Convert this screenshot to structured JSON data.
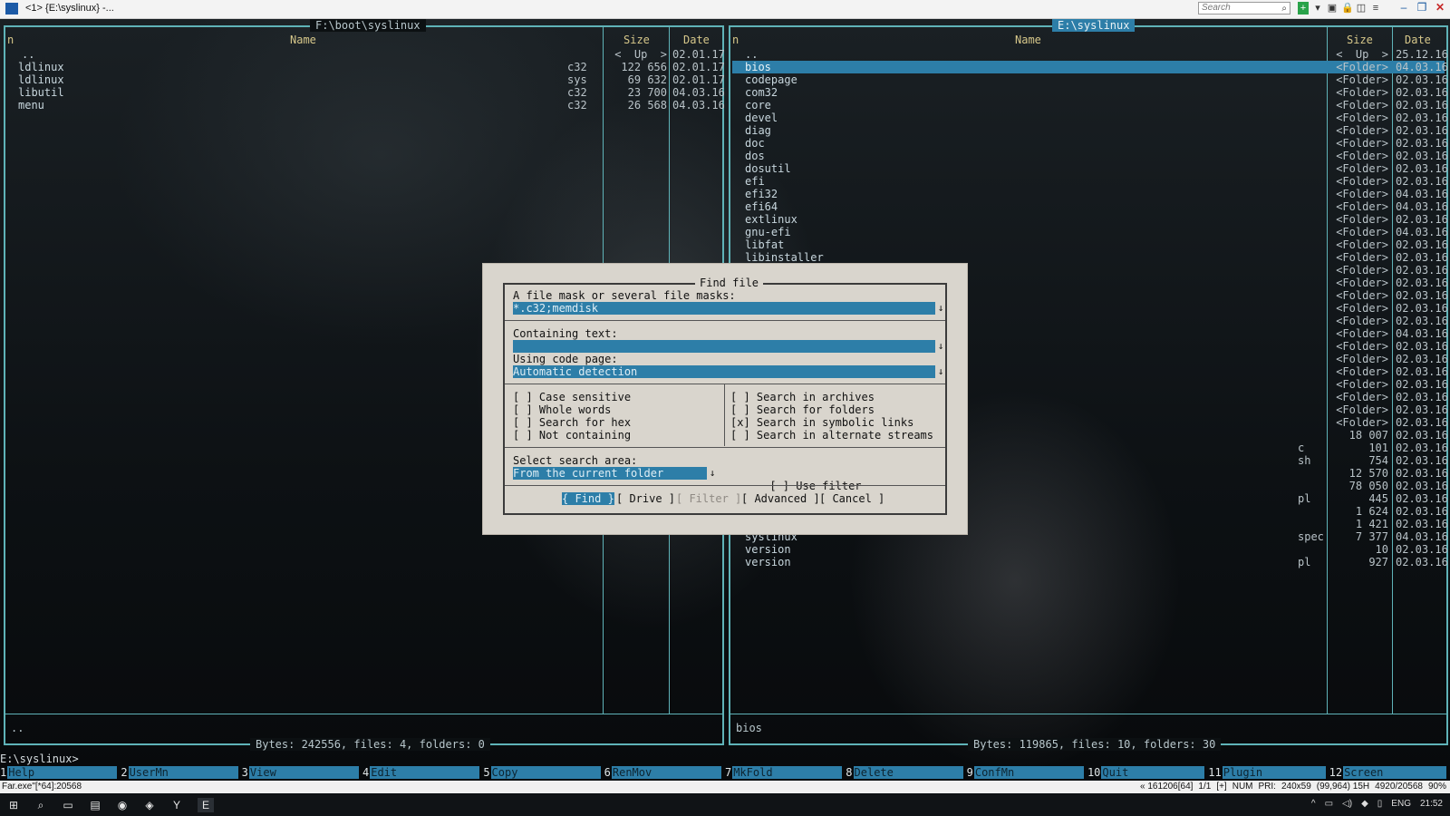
{
  "window": {
    "title": "<1> {E:\\syslinux} -...",
    "search_placeholder": "Search"
  },
  "left_panel": {
    "path": "F:\\boot\\syslinux",
    "col_name": "Name",
    "col_size": "Size",
    "col_date": "Date",
    "updir": "..",
    "up_size": "<  Up  >",
    "up_date": "02.01.17",
    "files": [
      {
        "name": "ldlinux",
        "ext": "c32",
        "size": "122 656",
        "date": "02.01.17"
      },
      {
        "name": "ldlinux",
        "ext": "sys",
        "size": "69 632",
        "date": "02.01.17"
      },
      {
        "name": "libutil",
        "ext": "c32",
        "size": "23 700",
        "date": "04.03.16"
      },
      {
        "name": "menu",
        "ext": "c32",
        "size": "26 568",
        "date": "04.03.16"
      }
    ],
    "status": "..",
    "bytes": "Bytes: 242556, files: 4, folders: 0"
  },
  "right_panel": {
    "path": "E:\\syslinux",
    "col_n": "n",
    "col_name": "Name",
    "col_size": "Size",
    "col_date": "Date",
    "updir": "..",
    "up_size": "<  Up  >",
    "up_date": "25.12.16",
    "folders": [
      {
        "name": "bios",
        "size": "<Folder>",
        "date": "04.03.16"
      },
      {
        "name": "codepage",
        "size": "<Folder>",
        "date": "02.03.16"
      },
      {
        "name": "com32",
        "size": "<Folder>",
        "date": "02.03.16"
      },
      {
        "name": "core",
        "size": "<Folder>",
        "date": "02.03.16"
      },
      {
        "name": "devel",
        "size": "<Folder>",
        "date": "02.03.16"
      },
      {
        "name": "diag",
        "size": "<Folder>",
        "date": "02.03.16"
      },
      {
        "name": "doc",
        "size": "<Folder>",
        "date": "02.03.16"
      },
      {
        "name": "dos",
        "size": "<Folder>",
        "date": "02.03.16"
      },
      {
        "name": "dosutil",
        "size": "<Folder>",
        "date": "02.03.16"
      },
      {
        "name": "efi",
        "size": "<Folder>",
        "date": "02.03.16"
      },
      {
        "name": "efi32",
        "size": "<Folder>",
        "date": "04.03.16"
      },
      {
        "name": "efi64",
        "size": "<Folder>",
        "date": "04.03.16"
      },
      {
        "name": "extlinux",
        "size": "<Folder>",
        "date": "02.03.16"
      },
      {
        "name": "gnu-efi",
        "size": "<Folder>",
        "date": "04.03.16"
      },
      {
        "name": "libfat",
        "size": "<Folder>",
        "date": "02.03.16"
      },
      {
        "name": "libinstaller",
        "size": "<Folder>",
        "date": "02.03.16"
      }
    ],
    "hidden_rows": [
      {
        "size": "<Folder>",
        "date": "02.03.16"
      },
      {
        "size": "<Folder>",
        "date": "02.03.16"
      },
      {
        "size": "<Folder>",
        "date": "02.03.16"
      },
      {
        "size": "<Folder>",
        "date": "02.03.16"
      },
      {
        "size": "<Folder>",
        "date": "02.03.16"
      },
      {
        "size": "<Folder>",
        "date": "04.03.16"
      },
      {
        "size": "<Folder>",
        "date": "02.03.16"
      },
      {
        "size": "<Folder>",
        "date": "02.03.16"
      },
      {
        "size": "<Folder>",
        "date": "02.03.16"
      },
      {
        "size": "<Folder>",
        "date": "02.03.16"
      },
      {
        "size": "<Folder>",
        "date": "02.03.16"
      },
      {
        "size": "<Folder>",
        "date": "02.03.16"
      },
      {
        "size": "<Folder>",
        "date": "02.03.16"
      },
      {
        "ext": "",
        "size": "18 007",
        "date": "02.03.16"
      },
      {
        "ext": "c",
        "size": "101",
        "date": "02.03.16"
      },
      {
        "ext": "sh",
        "size": "754",
        "date": "02.03.16"
      },
      {
        "ext": "",
        "size": "12 570",
        "date": "02.03.16"
      },
      {
        "ext": "",
        "size": "78 050",
        "date": "02.03.16"
      },
      {
        "ext": "pl",
        "size": "445",
        "date": "02.03.16"
      },
      {
        "ext": "",
        "size": "1 624",
        "date": "02.03.16"
      },
      {
        "ext": "",
        "size": "1 421",
        "date": "02.03.16"
      }
    ],
    "tail_files": [
      {
        "name": "syslinux",
        "ext": "spec",
        "size": "7 377",
        "date": "04.03.16"
      },
      {
        "name": "version",
        "ext": "",
        "size": "10",
        "date": "02.03.16"
      },
      {
        "name": "version",
        "ext": "pl",
        "size": "927",
        "date": "02.03.16"
      }
    ],
    "status": "bios",
    "bytes": "Bytes: 119865, files: 10, folders: 30"
  },
  "command_line": "E:\\syslinux>",
  "keybar": [
    {
      "num": "1",
      "label": "Help"
    },
    {
      "num": "2",
      "label": "UserMn"
    },
    {
      "num": "3",
      "label": "View"
    },
    {
      "num": "4",
      "label": "Edit"
    },
    {
      "num": "5",
      "label": "Copy"
    },
    {
      "num": "6",
      "label": "RenMov"
    },
    {
      "num": "7",
      "label": "MkFold"
    },
    {
      "num": "8",
      "label": "Delete"
    },
    {
      "num": "9",
      "label": "ConfMn"
    },
    {
      "num": "10",
      "label": "Quit"
    },
    {
      "num": "11",
      "label": "Plugin"
    },
    {
      "num": "12",
      "label": "Screen"
    }
  ],
  "dialog": {
    "title": "Find file",
    "mask_label": "A file mask or several file masks:",
    "mask_value": "*.c32;memdisk",
    "containing_label": "Containing text:",
    "containing_value": "",
    "codepage_label": "Using code page:",
    "codepage_value": "Automatic detection",
    "options_left": [
      {
        "check": "[ ]",
        "label": "Case sensitive"
      },
      {
        "check": "[ ]",
        "label": "Whole words"
      },
      {
        "check": "[ ]",
        "label": "Search for hex"
      },
      {
        "check": "[ ]",
        "label": "Not containing"
      }
    ],
    "options_right": [
      {
        "check": "[ ]",
        "label": "Search in archives"
      },
      {
        "check": "[ ]",
        "label": "Search for folders"
      },
      {
        "check": "[x]",
        "label": "Search in symbolic links"
      },
      {
        "check": "[ ]",
        "label": "Search in alternate streams"
      }
    ],
    "area_label": "Select search area:",
    "area_value": "From the current folder",
    "use_filter_check": "[ ]",
    "use_filter_label": "Use filter",
    "buttons": {
      "find": "{ Find }",
      "drive": "[ Drive ]",
      "filter": "[ Filter ]",
      "advanced": "[ Advanced ]",
      "cancel": "[ Cancel ]"
    }
  },
  "statusbar": {
    "left": "Far.exe\"[*64]:20568",
    "items": [
      "« 161206[64]",
      "1/1",
      "[+]",
      "NUM",
      "PRI:",
      "240x59",
      "(99,964) 15H",
      "4920/20568",
      "90%"
    ]
  },
  "taskbar": {
    "lang": "ENG",
    "clock": "21:52"
  }
}
